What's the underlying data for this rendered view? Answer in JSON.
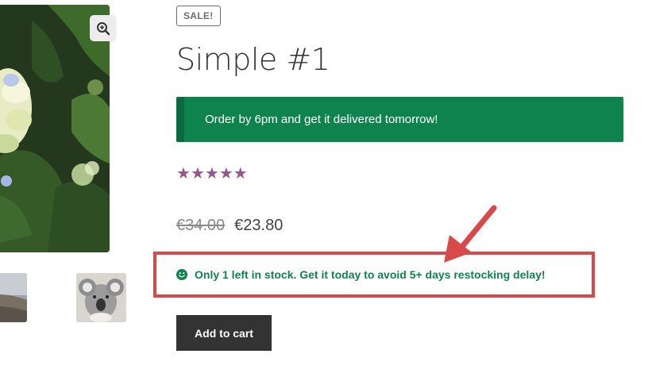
{
  "gallery": {
    "main_image_icon": "hydrangea-photo",
    "zoom_icon": "zoom-in-icon",
    "thumbnails": [
      {
        "icon": "landscape-photo"
      },
      {
        "icon": "koala-photo"
      }
    ]
  },
  "product": {
    "sale_badge": "SALE!",
    "title": "Simple #1",
    "delivery_notice": "Order by 6pm and get it delivered tomorrow!",
    "rating": {
      "stars": 5,
      "max": 5,
      "color": "#96588a",
      "icon": "star-icon"
    },
    "price": {
      "old": "€34.00",
      "current": "€23.80"
    },
    "stock_message": "Only 1 left in stock. Get it today to avoid 5+ days restocking delay!",
    "stock_icon": "smile-icon",
    "add_to_cart_label": "Add to cart"
  },
  "annotation": {
    "highlight_color": "#d84a4a"
  },
  "colors": {
    "delivery_bg": "#0f834d",
    "stock_text": "#0f834d",
    "button_bg": "#333333"
  }
}
